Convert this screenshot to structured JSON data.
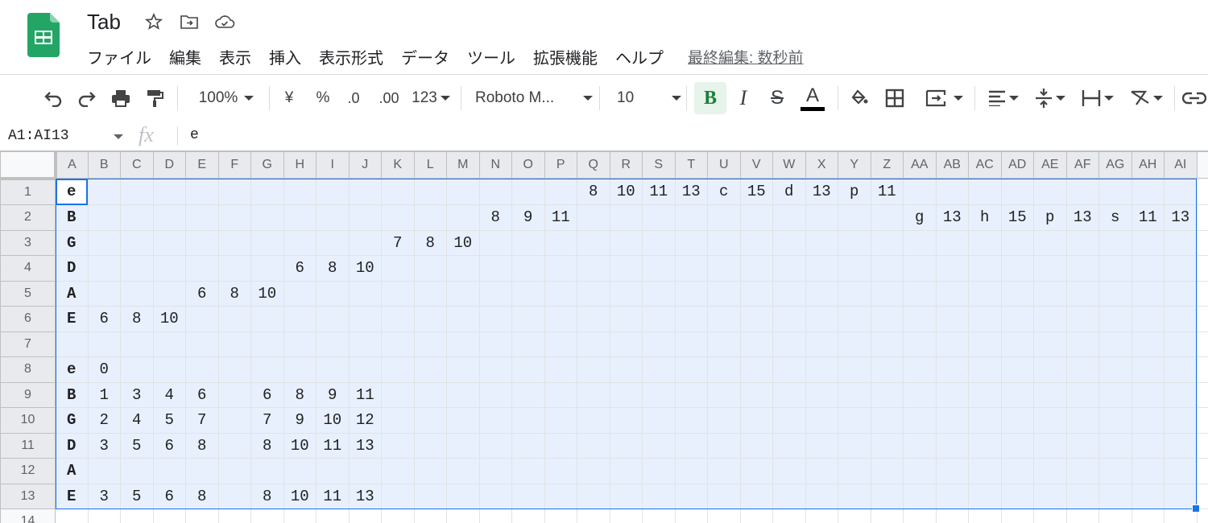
{
  "app": {
    "title": "Tab",
    "last_edit": "最終編集: 数秒前",
    "colors": {
      "brand_green": "#23a566",
      "selection": "#1a73e8",
      "selection_fill": "#e8f0fe"
    }
  },
  "menu": [
    "ファイル",
    "編集",
    "表示",
    "挿入",
    "表示形式",
    "データ",
    "ツール",
    "拡張機能",
    "ヘルプ"
  ],
  "toolbar": {
    "zoom": "100%",
    "currency": "¥",
    "percent": "%",
    "dec_decrease": ".0",
    "dec_increase": ".00",
    "format": "123",
    "font": "Roboto M...",
    "font_size": "10",
    "bold": "B",
    "italic": "I",
    "strike": "S",
    "text_color": "A"
  },
  "formula": {
    "namebox": "A1:AI13",
    "fx": "fx",
    "value": "e"
  },
  "sheet": {
    "columns": [
      "A",
      "B",
      "C",
      "D",
      "E",
      "F",
      "G",
      "H",
      "I",
      "J",
      "K",
      "L",
      "M",
      "N",
      "O",
      "P",
      "Q",
      "R",
      "S",
      "T",
      "U",
      "V",
      "W",
      "X",
      "Y",
      "Z",
      "AA",
      "AB",
      "AC",
      "AD",
      "AE",
      "AF",
      "AG",
      "AH",
      "AI"
    ],
    "rows": [
      {
        "n": "1",
        "cells": {
          "A": "e",
          "Q": "8",
          "R": "10",
          "S": "11",
          "T": "13",
          "U": "c",
          "V": "15",
          "W": "d",
          "X": "13",
          "Y": "p",
          "Z": "11"
        }
      },
      {
        "n": "2",
        "cells": {
          "A": "B",
          "N": "8",
          "O": "9",
          "P": "11",
          "AA": "g",
          "AB": "13",
          "AC": "h",
          "AD": "15",
          "AE": "p",
          "AF": "13",
          "AG": "s",
          "AH": "11",
          "AI": "13"
        }
      },
      {
        "n": "3",
        "cells": {
          "A": "G",
          "K": "7",
          "L": "8",
          "M": "10"
        }
      },
      {
        "n": "4",
        "cells": {
          "A": "D",
          "H": "6",
          "I": "8",
          "J": "10"
        }
      },
      {
        "n": "5",
        "cells": {
          "A": "A",
          "E": "6",
          "F": "8",
          "G": "10"
        }
      },
      {
        "n": "6",
        "cells": {
          "A": "E",
          "B": "6",
          "C": "8",
          "D": "10"
        }
      },
      {
        "n": "7",
        "cells": {}
      },
      {
        "n": "8",
        "cells": {
          "A": "e",
          "B": "0"
        }
      },
      {
        "n": "9",
        "cells": {
          "A": "B",
          "B": "1",
          "C": "3",
          "D": "4",
          "E": "6",
          "G": "6",
          "H": "8",
          "I": "9",
          "J": "11"
        }
      },
      {
        "n": "10",
        "cells": {
          "A": "G",
          "B": "2",
          "C": "4",
          "D": "5",
          "E": "7",
          "G": "7",
          "H": "9",
          "I": "10",
          "J": "12"
        }
      },
      {
        "n": "11",
        "cells": {
          "A": "D",
          "B": "3",
          "C": "5",
          "D": "6",
          "E": "8",
          "G": "8",
          "H": "10",
          "I": "11",
          "J": "13"
        }
      },
      {
        "n": "12",
        "cells": {
          "A": "A"
        }
      },
      {
        "n": "13",
        "cells": {
          "A": "E",
          "B": "3",
          "C": "5",
          "D": "6",
          "E": "8",
          "G": "8",
          "H": "10",
          "I": "11",
          "J": "13"
        }
      },
      {
        "n": "14",
        "cells": {}
      }
    ]
  }
}
